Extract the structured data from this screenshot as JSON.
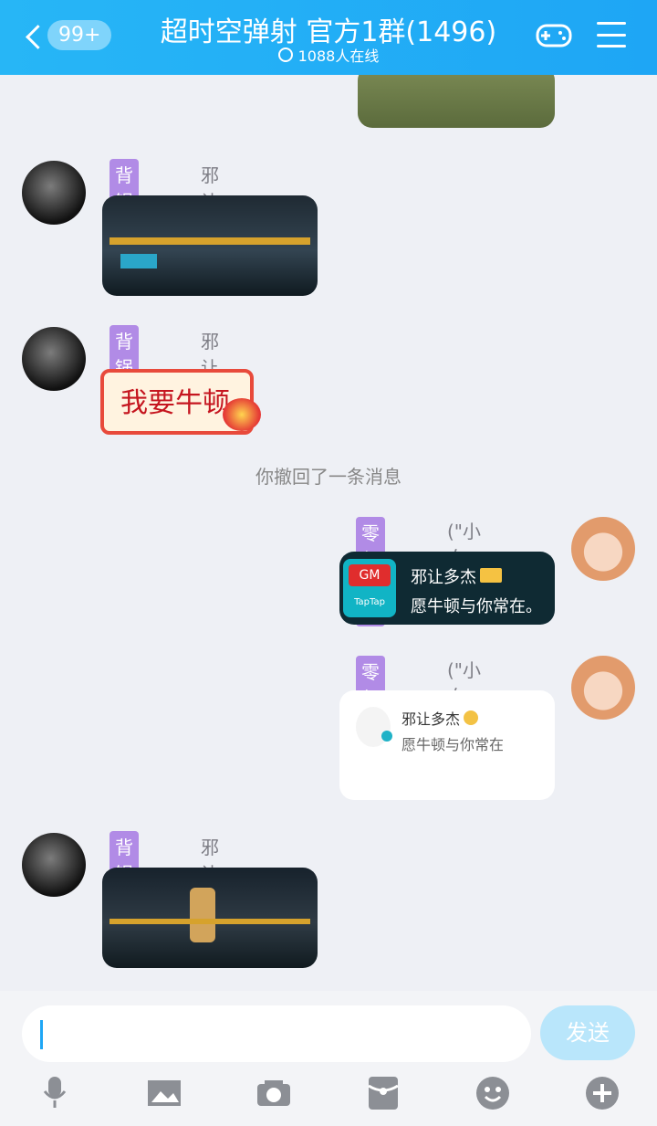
{
  "header": {
    "back_badge": "99+",
    "title": "超时空弹射 官方1群(1496)",
    "subtitle": "1088人在线"
  },
  "messages": [
    {
      "type": "image",
      "side": "left",
      "tag": "背锅运营",
      "name": "邪让多杰"
    },
    {
      "type": "sticker",
      "side": "left",
      "tag": "背锅运营",
      "name": "邪让多杰",
      "sticker_text": "我要牛顿"
    },
    {
      "type": "recall",
      "text": "你撤回了一条消息"
    },
    {
      "type": "card",
      "side": "right",
      "tag": "零氪萌新",
      "name": "(\"小白不白\")",
      "card_title": "邪让多杰",
      "card_sub": "愿牛顿与你常在。",
      "badge1": "GM",
      "badge2": "TapTap"
    },
    {
      "type": "profile",
      "side": "right",
      "tag": "零氪萌新",
      "name": "(\"小白不白\")",
      "profile_name": "邪让多杰",
      "profile_sub": "愿牛顿与你常在"
    },
    {
      "type": "image",
      "side": "left",
      "tag": "背锅运营",
      "name": "邪让多杰"
    }
  ],
  "input": {
    "placeholder": "",
    "send_label": "发送"
  },
  "toolbar": [
    "mic-icon",
    "image-icon",
    "camera-icon",
    "red-packet-icon",
    "emoji-icon",
    "plus-icon"
  ],
  "colors": {
    "header": "#1ea6f5",
    "tag": "#b18be6"
  }
}
